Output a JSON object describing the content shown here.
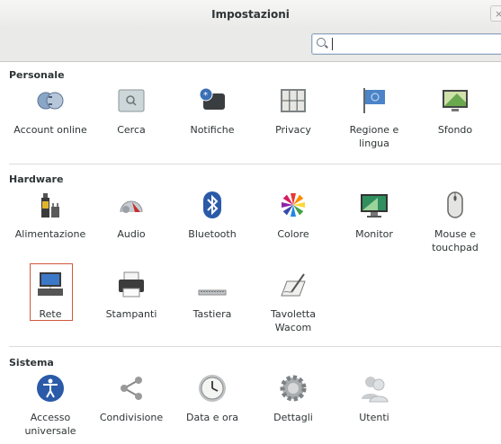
{
  "window": {
    "title": "Impostazioni",
    "close": "×"
  },
  "search": {
    "value": "",
    "placeholder": ""
  },
  "sections": [
    {
      "title": "Personale",
      "items": [
        {
          "label": "Account online",
          "icon": "online-accounts-icon"
        },
        {
          "label": "Cerca",
          "icon": "search-settings-icon"
        },
        {
          "label": "Notifiche",
          "icon": "notifications-icon"
        },
        {
          "label": "Privacy",
          "icon": "privacy-icon"
        },
        {
          "label": "Regione e lingua",
          "icon": "region-language-icon"
        },
        {
          "label": "Sfondo",
          "icon": "background-icon"
        }
      ]
    },
    {
      "title": "Hardware",
      "items": [
        {
          "label": "Alimentazione",
          "icon": "power-icon"
        },
        {
          "label": "Audio",
          "icon": "sound-icon"
        },
        {
          "label": "Bluetooth",
          "icon": "bluetooth-icon"
        },
        {
          "label": "Colore",
          "icon": "color-icon"
        },
        {
          "label": "Monitor",
          "icon": "display-icon"
        },
        {
          "label": "Mouse e touchpad",
          "icon": "mouse-icon"
        },
        {
          "label": "Rete",
          "icon": "network-icon"
        },
        {
          "label": "Stampanti",
          "icon": "printer-icon"
        },
        {
          "label": "Tastiera",
          "icon": "keyboard-icon"
        },
        {
          "label": "Tavoletta Wacom",
          "icon": "wacom-icon"
        }
      ]
    },
    {
      "title": "Sistema",
      "items": [
        {
          "label": "Accesso universale",
          "icon": "accessibility-icon"
        },
        {
          "label": "Condivisione",
          "icon": "sharing-icon"
        },
        {
          "label": "Data e ora",
          "icon": "clock-icon"
        },
        {
          "label": "Dettagli",
          "icon": "details-gear-icon"
        },
        {
          "label": "Utenti",
          "icon": "users-icon"
        }
      ]
    }
  ],
  "colors": {
    "selection": "#d2573a",
    "accent": "#3b6fb6"
  }
}
